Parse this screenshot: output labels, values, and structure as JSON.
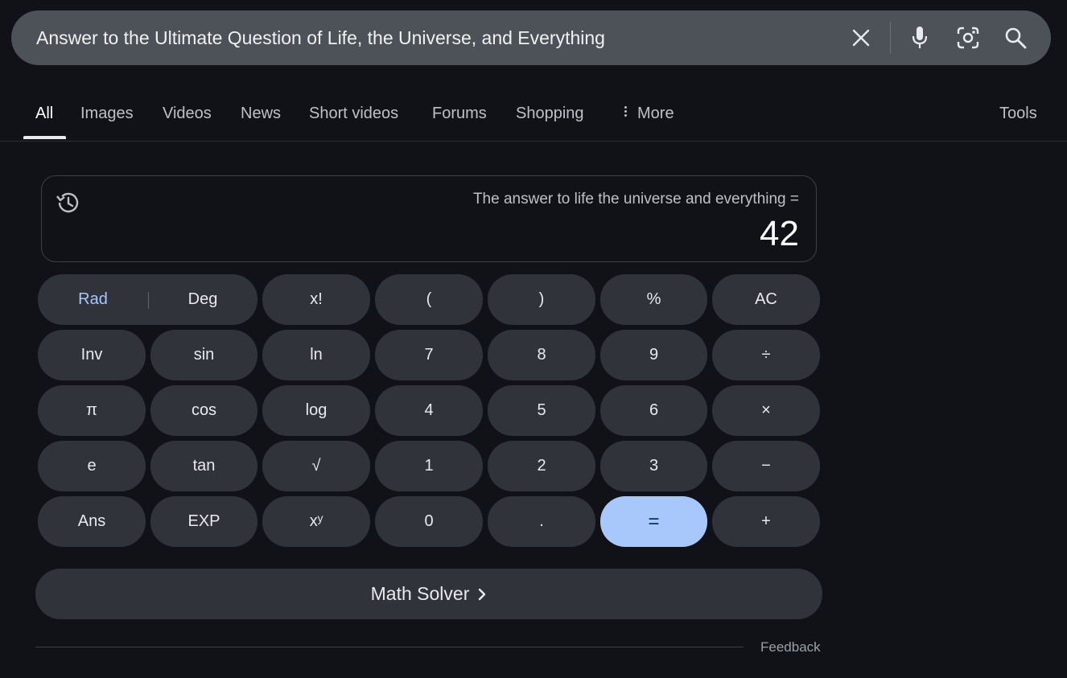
{
  "search": {
    "query": "Answer to the Ultimate Question of Life, the Universe, and Everything",
    "icons": [
      "close-icon",
      "microphone-icon",
      "lens-icon",
      "search-icon"
    ]
  },
  "tabs": [
    {
      "label": "All",
      "active": true
    },
    {
      "label": "Images"
    },
    {
      "label": "Videos"
    },
    {
      "label": "News"
    },
    {
      "label": "Short videos"
    },
    {
      "label": "Forums"
    },
    {
      "label": "Shopping"
    },
    {
      "label": "More"
    },
    {
      "label": "Tools"
    }
  ],
  "calculator": {
    "expression": "The answer to life the universe and everything =",
    "result": "42",
    "mode": {
      "rad": "Rad",
      "deg": "Deg",
      "selected": "Rad"
    },
    "keys": {
      "fact": "x!",
      "lparen": "(",
      "rparen": ")",
      "percent": "%",
      "ac": "AC",
      "inv": "Inv",
      "sin": "sin",
      "ln": "ln",
      "k7": "7",
      "k8": "8",
      "k9": "9",
      "div": "÷",
      "pi": "π",
      "cos": "cos",
      "log": "log",
      "k4": "4",
      "k5": "5",
      "k6": "6",
      "mul": "×",
      "e": "e",
      "tan": "tan",
      "sqrt": "√",
      "k1": "1",
      "k2": "2",
      "k3": "3",
      "minus": "−",
      "ans": "Ans",
      "exp": "EXP",
      "pow": "xʸ",
      "k0": "0",
      "dot": ".",
      "eq": "=",
      "plus": "+"
    },
    "accent_color": "#a8c7fa"
  },
  "math_solver": {
    "label": "Math Solver"
  },
  "feedback": {
    "label": "Feedback"
  }
}
